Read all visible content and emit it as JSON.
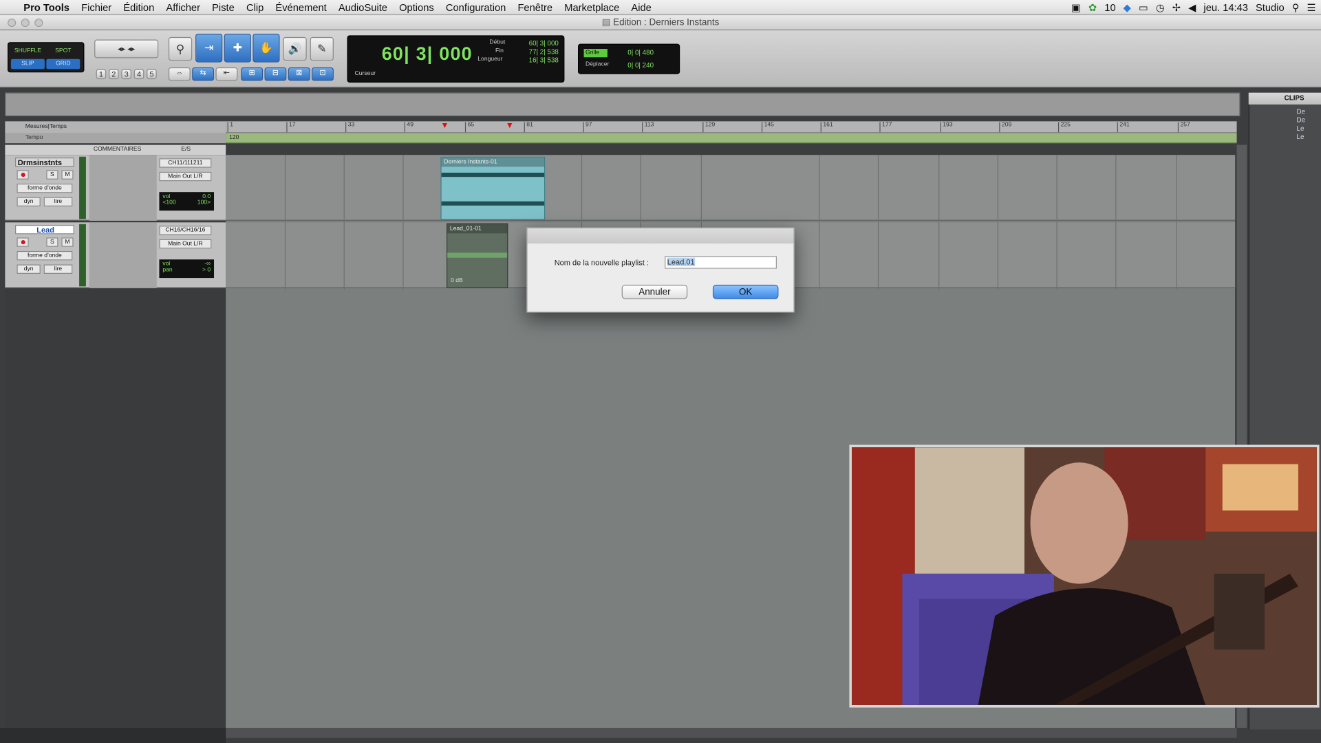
{
  "menubar": {
    "app": "Pro Tools",
    "items": [
      "Fichier",
      "Édition",
      "Afficher",
      "Piste",
      "Clip",
      "Événement",
      "AudioSuite",
      "Options",
      "Configuration",
      "Fenêtre",
      "Marketplace",
      "Aide"
    ],
    "status_number": "10",
    "clock": "jeu. 14:43",
    "user": "Studio"
  },
  "window": {
    "title": "Edition : Derniers Instants"
  },
  "toolbar": {
    "modes": {
      "shuffle": "SHUFFLE",
      "spot": "SPOT",
      "slip": "SLIP",
      "grid": "GRID"
    },
    "zoom_presets": [
      "1",
      "2",
      "3",
      "4",
      "5"
    ],
    "counter_main": "60| 3| 000",
    "counter_labels": {
      "start": "Début",
      "end": "Fin",
      "length": "Longueur",
      "cursor": "Curseur"
    },
    "counter_values": {
      "start": "60| 3| 000",
      "end": "77| 2| 538",
      "length": "16| 3| 538"
    },
    "grid_label": "Grille",
    "grid_value": "0| 0| 480",
    "nudge_label": "Déplacer",
    "nudge_value": "0| 0| 240"
  },
  "rulers": {
    "bars_label": "Mesures|Temps",
    "tempo_label": "Tempo",
    "tempo_value": "120",
    "bar_ticks": [
      "1",
      "17",
      "33",
      "49",
      "65",
      "81",
      "97",
      "113",
      "129",
      "145",
      "161",
      "177",
      "193",
      "209",
      "225",
      "241",
      "257"
    ]
  },
  "track_columns": {
    "comments": "COMMENTAIRES",
    "io": "E/S"
  },
  "tracks": [
    {
      "name": "Drmsinstnts",
      "view": "forme d'onde",
      "dyn": "dyn",
      "lire": "lire",
      "input": "CH11/111211",
      "output": "Main Out L/R",
      "vol_label": "vol",
      "vol_value": "0.0",
      "pan_left": "<100",
      "pan_right": "100>",
      "solo": "S",
      "mute": "M",
      "clip": "Derniers Instants-01"
    },
    {
      "name": "Lead",
      "view": "forme d'onde",
      "dyn": "dyn",
      "lire": "lire",
      "input": "CH16/CH16/16",
      "output": "Main Out L/R",
      "vol_label": "vol",
      "vol_value": "-∞",
      "pan_label": "pan",
      "pan_value": "> 0",
      "solo": "S",
      "mute": "M",
      "clip": "Lead_01-01",
      "clip_gain": "0 dB"
    }
  ],
  "clips_panel": {
    "title": "CLIPS",
    "items": [
      "Dе",
      "De",
      "Le",
      "Le"
    ]
  },
  "dialog": {
    "label": "Nom de la nouvelle playlist :",
    "input_value": "Lead.01",
    "cancel": "Annuler",
    "ok": "OK"
  },
  "colors": {
    "counter_green": "#7fe35f",
    "ok_blue": "#3f8be6",
    "tempo_green": "#9bb97f",
    "clip_cyan": "#7fc1c8"
  }
}
